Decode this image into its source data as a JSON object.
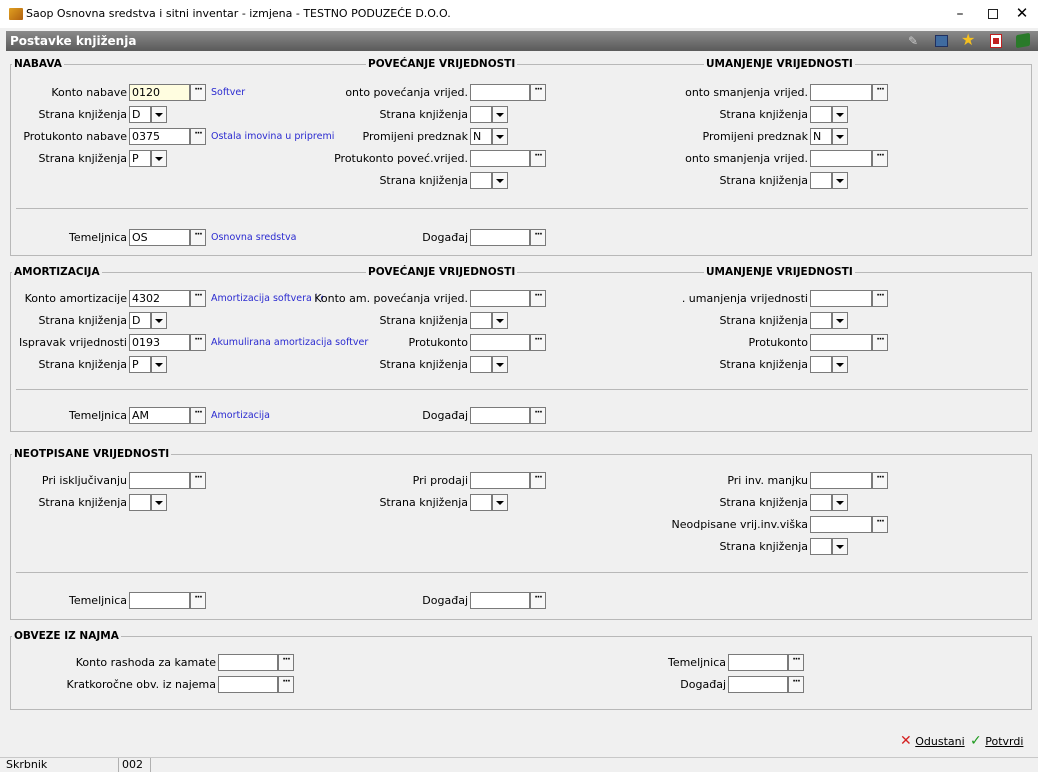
{
  "window": {
    "title": "Saop Osnovna sredstva i sitni inventar - izmjena  - TESTNO PODUZEĆE D.O.O."
  },
  "panel": {
    "title": "Postavke knjiženja"
  },
  "nabava": {
    "title": "NABAVA",
    "povecanje_title": "POVEĆANJE VRIJEDNOSTI",
    "umanjenje_title": "UMANJENJE VRIJEDNOSTI",
    "konto_nabave_label": "Konto nabave",
    "konto_nabave": "0120",
    "konto_nabave_desc": "Softver",
    "strana1_label": "Strana knjiženja",
    "strana1": "D",
    "protukonto_label": "Protukonto nabave",
    "protukonto": "0375",
    "protukonto_desc": "Ostala imovina u pripremi",
    "strana2_label": "Strana knjiženja",
    "strana2": "P",
    "p_konto_label": "onto povećanja vrijed.",
    "p_konto": "",
    "p_strana1_label": "Strana knjiženja",
    "p_strana1": "",
    "p_predznak_label": "Promijeni predznak",
    "p_predznak": "N",
    "p_protukonto_label": "Protukonto poveć.vrijed.",
    "p_protukonto": "",
    "p_strana2_label": "Strana knjiženja",
    "p_strana2": "",
    "u_konto_label": "onto smanjenja vrijed.",
    "u_konto": "",
    "u_strana1_label": "Strana knjiženja",
    "u_strana1": "",
    "u_predznak_label": "Promijeni predznak",
    "u_predznak": "N",
    "u_konto2_label": "onto smanjenja vrijed.",
    "u_konto2": "",
    "u_strana2_label": "Strana knjiženja",
    "u_strana2": "",
    "temeljnica_label": "Temeljnica",
    "temeljnica": "OS",
    "temeljnica_desc": "Osnovna sredstva",
    "dogadaj_label": "Događaj",
    "dogadaj": ""
  },
  "amortizacija": {
    "title": "AMORTIZACIJA",
    "povecanje_title": "POVEĆANJE VRIJEDNOSTI",
    "umanjenje_title": "UMANJENJE VRIJEDNOSTI",
    "konto_label": "Konto amortizacije",
    "konto": "4302",
    "konto_desc": "Amortizacija softvera i ost",
    "strana1_label": "Strana knjiženja",
    "strana1": "D",
    "ispravak_label": "Ispravak vrijednosti",
    "ispravak": "0193",
    "ispravak_desc": "Akumulirana amortizacija softver",
    "strana2_label": "Strana knjiženja",
    "strana2": "P",
    "p_konto_label": "Konto am. povećanja vrijed.",
    "p_konto": "",
    "p_strana1_label": "Strana knjiženja",
    "p_strana1": "",
    "p_protukonto_label": "Protukonto",
    "p_protukonto": "",
    "p_strana2_label": "Strana knjiženja",
    "p_strana2": "",
    "u_konto_label": ". umanjenja vrijednosti",
    "u_konto": "",
    "u_strana1_label": "Strana knjiženja",
    "u_strana1": "",
    "u_protukonto_label": "Protukonto",
    "u_protukonto": "",
    "u_strana2_label": "Strana knjiženja",
    "u_strana2": "",
    "temeljnica_label": "Temeljnica",
    "temeljnica": "AM",
    "temeljnica_desc": "Amortizacija",
    "dogadaj_label": "Događaj",
    "dogadaj": ""
  },
  "neotpisane": {
    "title": "NEOTPISANE VRIJEDNOSTI",
    "iskljucivanje_label": "Pri isključivanju",
    "iskljucivanje": "",
    "strana1_label": "Strana knjiženja",
    "strana1": "",
    "prodaja_label": "Pri prodaji",
    "prodaja": "",
    "strana2_label": "Strana knjiženja",
    "strana2": "",
    "manjak_label": "Pri inv. manjku",
    "manjak": "",
    "strana3_label": "Strana knjiženja",
    "strana3": "",
    "visak_label": "Neodpisane vrij.inv.viška",
    "visak": "",
    "strana4_label": "Strana knjiženja",
    "strana4": "",
    "temeljnica_label": "Temeljnica",
    "temeljnica": "",
    "dogadaj_label": "Događaj",
    "dogadaj": ""
  },
  "najam": {
    "title": "OBVEZE IZ NAJMA",
    "rashod_label": "Konto rashoda za kamate",
    "rashod": "",
    "kratkorocne_label": "Kratkoročne  obv. iz najema",
    "kratkorocne": "",
    "temeljnica_label": "Temeljnica",
    "temeljnica": "",
    "dogadaj_label": "Događaj",
    "dogadaj": ""
  },
  "footer": {
    "cancel": "Odustani",
    "confirm": "Potvrdi"
  },
  "status": {
    "user_label": "Skrbnik",
    "user_code": "002"
  },
  "colors": {
    "panel_header": "#6d6d6d",
    "link_blue": "#2a2ad0",
    "cancel_red": "#d42020",
    "confirm_green": "#1e9a1e"
  }
}
